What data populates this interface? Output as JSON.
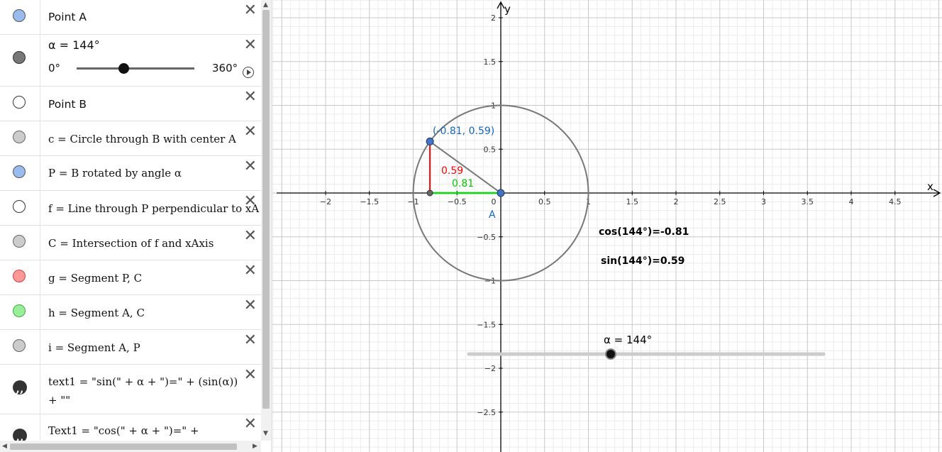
{
  "algebra": {
    "rows": [
      {
        "label": "Point A",
        "marble_color": "#99bbee"
      },
      {
        "label": "α = 144°",
        "min": "0°",
        "max": "360°",
        "value": 144,
        "marble_color": "#777777"
      },
      {
        "label": "Point B",
        "marble_color": "#ffffff"
      },
      {
        "label": "c = Circle through B with center A",
        "marble_color": "#cccccc"
      },
      {
        "label": "P = B rotated by angle α",
        "marble_color": "#99bbee"
      },
      {
        "label": "f = Line through P perpendicular to xA",
        "marble_color": "#ffffff"
      },
      {
        "label": "C = Intersection of f and xAxis",
        "marble_color": "#cccccc"
      },
      {
        "label": "g = Segment P, C",
        "marble_color": "#ff9999"
      },
      {
        "label": "h = Segment A, C",
        "marble_color": "#99ee99"
      },
      {
        "label": "i = Segment A, P",
        "marble_color": "#cccccc"
      },
      {
        "label": "text1 = \"sin(\" + α + \")=\" + (sin(α))",
        "label2": "+ \"\""
      },
      {
        "label": "Text1 = \"cos(\" + α + \")=\" +"
      }
    ],
    "close_symbol": "✕"
  },
  "graphics": {
    "x_axis_label": "x",
    "y_axis_label": "y",
    "x_ticks": [
      "−2",
      "−1.5",
      "−1",
      "−0.5",
      "0",
      "0.5",
      "1",
      "1.5",
      "2",
      "2.5",
      "3",
      "3.5",
      "4",
      "4.5"
    ],
    "y_ticks": [
      "2",
      "1.5",
      "1",
      "0.5",
      "−0.5",
      "−1",
      "−1.5",
      "−2",
      "−2.5"
    ],
    "point_P_label": "(-0.81, 0.59)",
    "point_A_label": "A",
    "sin_value_label": "0.59",
    "cos_value_label": "0.81",
    "cos_text": "cos(144°)=-0.81",
    "sin_text": "sin(144°)=0.59",
    "slider_label": "α = 144°",
    "slider_value": 144,
    "slider_max": 360,
    "colors": {
      "point": "#4472c4",
      "sin": "#ff0000",
      "cos": "#00dd00",
      "circle": "#777777",
      "label_blue": "#1565c0"
    }
  }
}
